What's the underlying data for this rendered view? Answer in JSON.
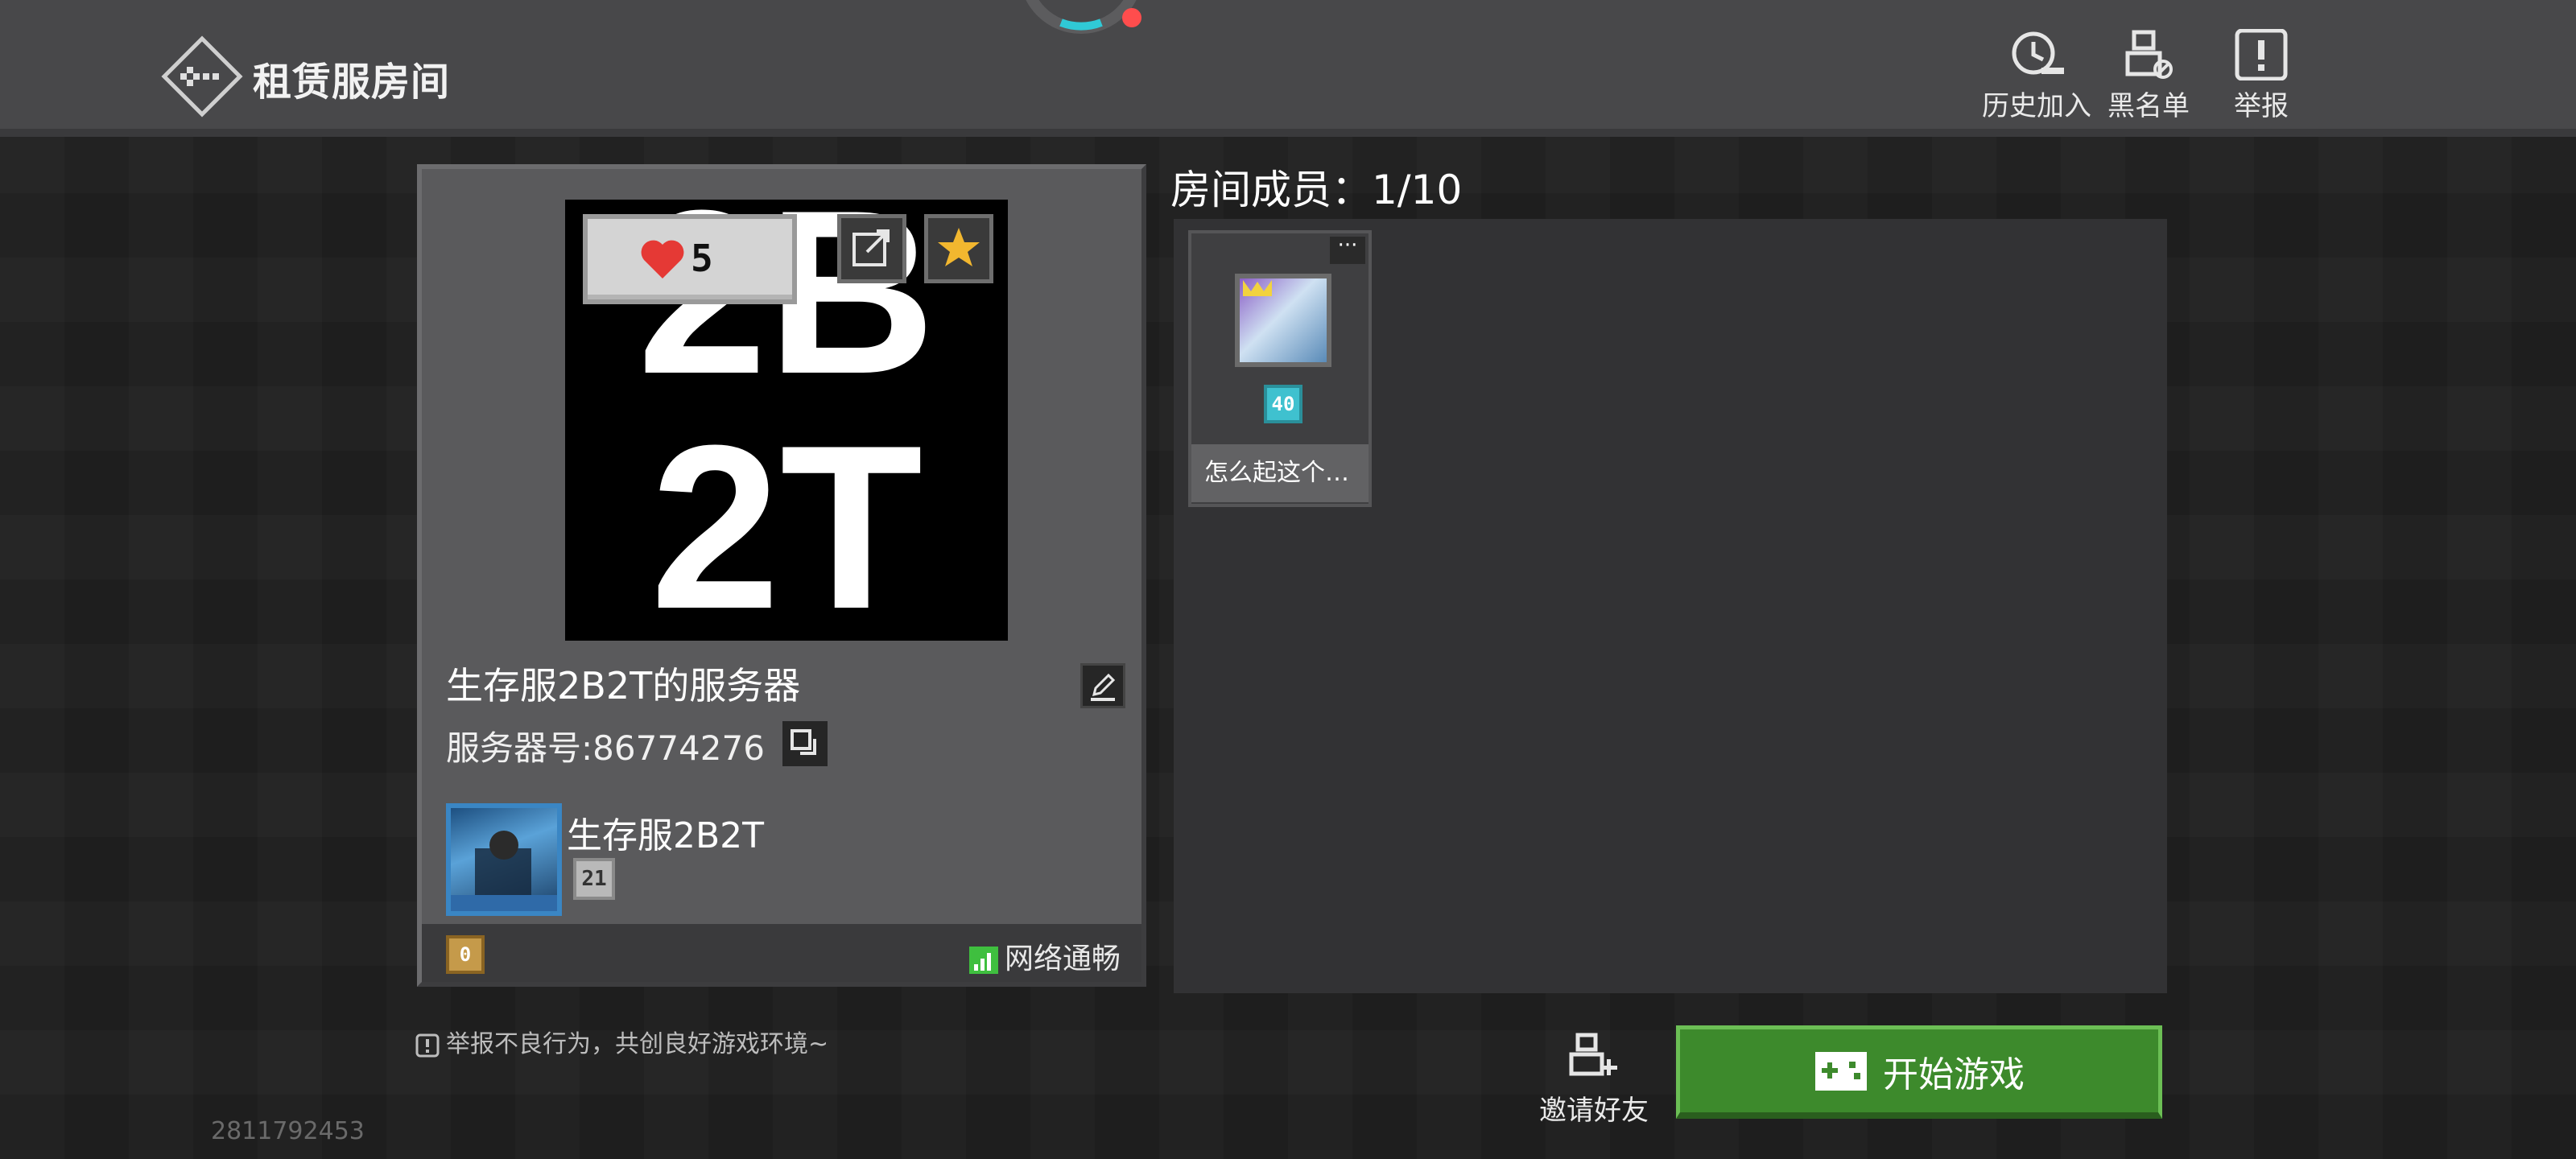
{
  "header": {
    "title": "租赁服房间",
    "actions": [
      {
        "label": "历史加入",
        "icon": "history-icon"
      },
      {
        "label": "黑名单",
        "icon": "blacklist-icon"
      },
      {
        "label": "举报",
        "icon": "report-icon"
      }
    ]
  },
  "server": {
    "cover_text_line1": "2B",
    "cover_text_line2": "2T",
    "likes": "5",
    "name": "生存服2B2T的服务器",
    "server_id": "服务器号:86774276",
    "owner_name": "生存服2B2T",
    "owner_level": "21",
    "footer_badge": "0",
    "network_status": "网络通畅"
  },
  "members": {
    "title": "房间成员：",
    "count": "1/10",
    "list": [
      {
        "name": "怎么起这个…",
        "level": "40",
        "more": "···"
      }
    ]
  },
  "footer": {
    "report_tip": "举报不良行为，共创良好游戏环境~",
    "invite_label": "邀请好友",
    "start_label": "开始游戏",
    "build_id": "2811792453"
  },
  "colors": {
    "accent_green": "#3d8a2c",
    "like_red": "#e53935",
    "star_gold": "#f2b72f",
    "network_green": "#3fbf3f"
  }
}
